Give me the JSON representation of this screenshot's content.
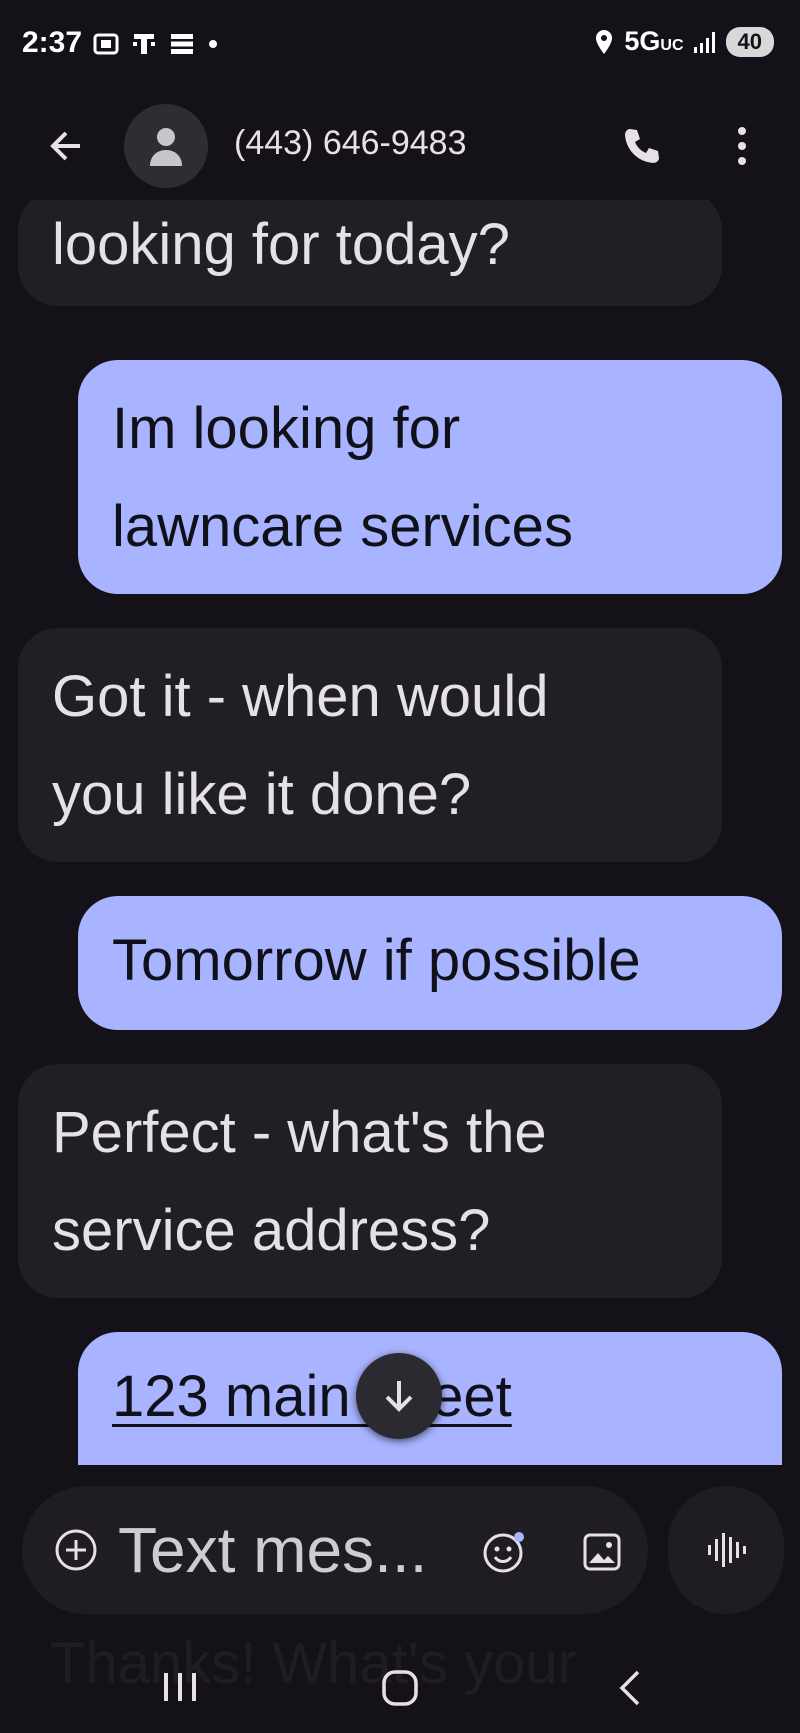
{
  "status_bar": {
    "time": "2:37",
    "network": "5G",
    "network_suffix": "UC",
    "battery": "40"
  },
  "app_bar": {
    "contact_title": "(443) 646-9483",
    "icons": [
      "back-arrow-icon",
      "person-icon",
      "phone-icon",
      "more-vert-icon"
    ]
  },
  "messages": [
    {
      "direction": "incoming",
      "text": "looking for today?"
    },
    {
      "direction": "outgoing",
      "lines": [
        "Im looking for",
        "lawncare services"
      ]
    },
    {
      "direction": "incoming",
      "lines": [
        "Got it - when would",
        "you like it done?"
      ]
    },
    {
      "direction": "outgoing",
      "text": "Tomorrow if possible"
    },
    {
      "direction": "incoming",
      "lines": [
        "Perfect - what's the",
        "service address?"
      ]
    },
    {
      "direction": "outgoing",
      "text": "123 main street"
    }
  ],
  "composer": {
    "placeholder": "Text mes..."
  },
  "faded_next_message": "Thanks! What's your",
  "colors": {
    "background": "#141218",
    "incoming_bubble": "#211f26",
    "outgoing_bubble": "#a8b4ff"
  }
}
